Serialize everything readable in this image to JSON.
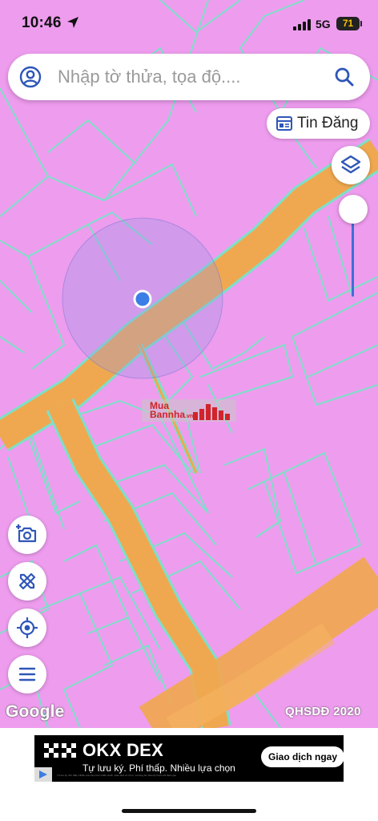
{
  "status_bar": {
    "time": "10:46",
    "network": "5G",
    "battery": "71",
    "battery_level": 0.71
  },
  "search": {
    "placeholder": "Nhập tờ thửa, tọa độ....",
    "user_icon": "user-circle-icon",
    "search_icon": "search-icon"
  },
  "tin_dang": {
    "label": "Tin Đăng",
    "icon": "listing-icon"
  },
  "map": {
    "layer_label": "QHSDĐ 2020",
    "provider": "Google",
    "watermark_text_top": "Mua",
    "watermark_text_bottom": "Bannha",
    "watermark_suffix": ".vn",
    "opacity_slider_value": 1.0,
    "colors": {
      "land": "#ee9cee",
      "road": "#f0a850",
      "parcel_line": "#7de0c8",
      "location": "#3a7ee6"
    }
  },
  "buttons": {
    "layers": "layers-icon",
    "camera": "add-photo-icon",
    "measure": "ruler-pencil-icon",
    "locate": "my-location-icon",
    "menu": "menu-icon"
  },
  "ad": {
    "title": "OKX DEX",
    "subtitle": "Tự lưu ký. Phí thấp. Nhiều lựa chọn",
    "cta": "Giao dịch ngay",
    "fine_print": "Tự lưu ký. Phí thấp. Nhiều lựa chọn trên nhiều chuỗi. Giao dịch có rủi ro, vui lòng tìm hiểu kỹ trước khi tham gia."
  }
}
